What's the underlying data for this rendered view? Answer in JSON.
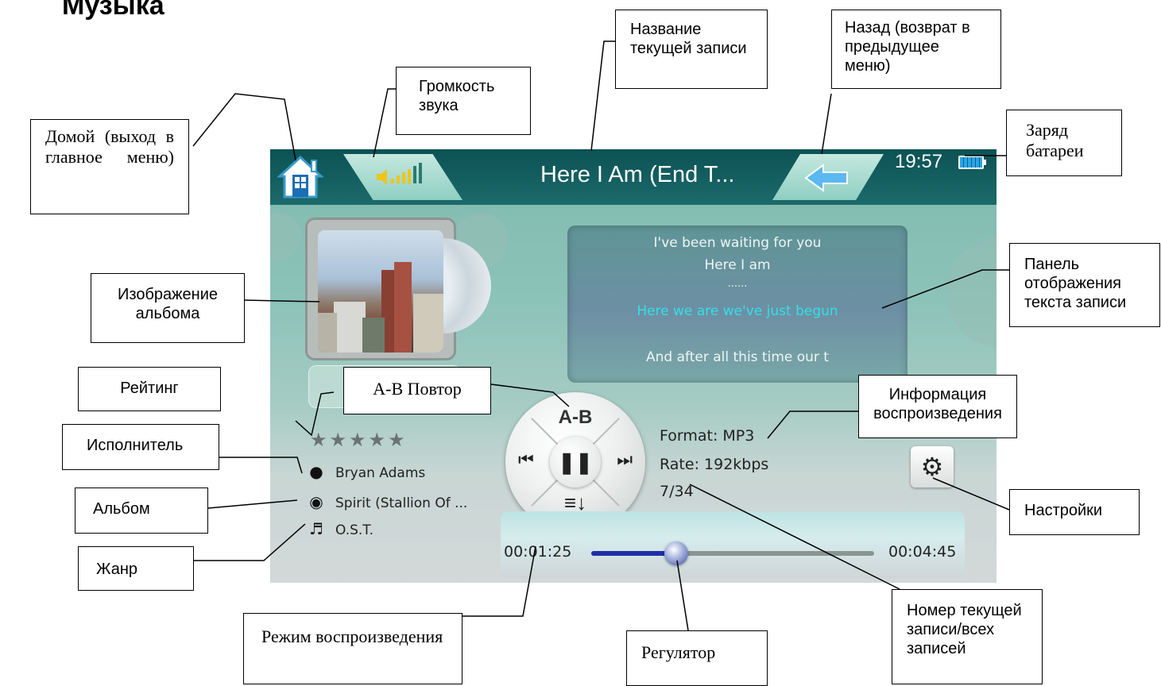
{
  "heading": "Музыка",
  "device": {
    "song_title": "Here I Am (End T...",
    "clock": "19:57",
    "lyrics": [
      "I've been waiting for you",
      "Here I am",
      "......",
      "Here we are    we've just begun",
      "",
      "And after all this time    our t"
    ],
    "highlight_line_index": 3,
    "rating_stars": "★★★★★",
    "artist": "Bryan Adams",
    "album": "Spirit (Stallion Of ...",
    "genre": "O.S.T.",
    "controls": {
      "ab_label": "A-B",
      "prev_icon": "previous-icon",
      "next_icon": "next-icon",
      "pause_icon": "pause-icon",
      "mode_icon": "play-mode-icon"
    },
    "format_label": "Format:",
    "format_value": "MP3",
    "rate_label": "Rate:",
    "rate_value": "192kbps",
    "track_counter": "7/34",
    "elapsed": "00:01:25",
    "total": "00:04:45",
    "progress": 0.3,
    "colors": {
      "topbar": "#0c5255",
      "lyric_highlight": "#33e0e6",
      "progress_fill": "#1f2fa8"
    }
  },
  "callouts": {
    "home": "Домой (выход в главное меню)",
    "volume": "Громкость звука",
    "title": "Название текущей записи",
    "back": "Назад (возврат в предыдущее меню)",
    "battery": "Заряд батареи",
    "album_image": "Изображение альбома",
    "lyrics_panel": "Панель отображения текста записи",
    "rating": "Рейтинг",
    "ab_repeat": "A-B Повтор",
    "playback_info": "Информация воспроизведения",
    "artist": "Исполнитель",
    "album": "Альбом",
    "settings": "Настройки",
    "genre": "Жанр",
    "play_mode": "Режим воспроизведения",
    "slider": "Регулятор",
    "track_number": "Номер текущей записи/всех записей"
  }
}
